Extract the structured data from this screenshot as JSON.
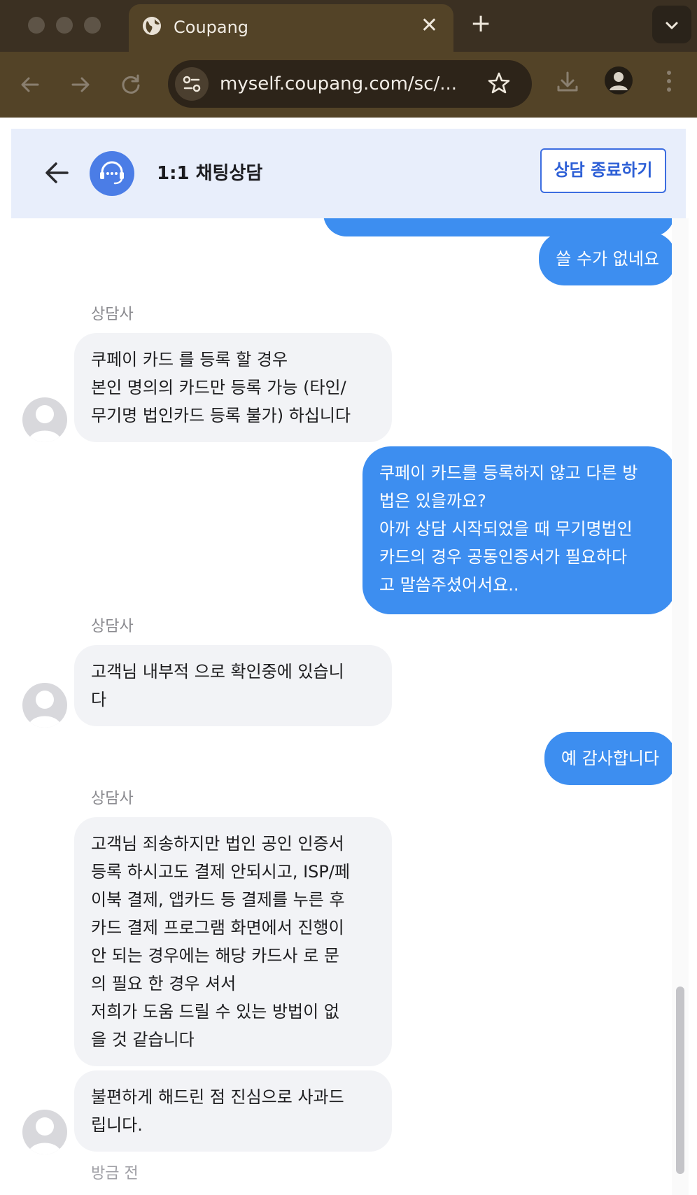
{
  "browser": {
    "tab_title": "Coupang",
    "url": "myself.coupang.com/sc/...",
    "new_tab_symbol": "+",
    "close_symbol": "✕"
  },
  "header": {
    "title": "1:1 채팅상담",
    "end_button": "상담 종료하기"
  },
  "messages": [
    {
      "from": "me",
      "text": "쓸 수가 없네요"
    },
    {
      "from": "agent",
      "sender": "상담사",
      "text": "쿠페이 카드 를 등록 할 경우\n본인 명의의 카드만 등록 가능 (타인/\n무기명 법인카드 등록 불가) 하십니다"
    },
    {
      "from": "me",
      "text": "쿠페이 카드를 등록하지 않고 다른 방\n법은 있을까요?\n아까 상담 시작되었을 때 무기명법인\n카드의 경우 공동인증서가 필요하다\n고 말씀주셨어서요.."
    },
    {
      "from": "agent",
      "sender": "상담사",
      "text": "고객님 내부적 으로 확인중에 있습니\n다"
    },
    {
      "from": "me",
      "text": "예 감사합니다"
    },
    {
      "from": "agent",
      "sender": "상담사",
      "text": "고객님 죄송하지만 법인 공인 인증서\n등록 하시고도 결제 안되시고, ISP/페\n이북 결제, 앱카드 등 결제를 누른 후\n카드 결제 프로그램 화면에서 진행이\n안 되는 경우에는 해당 카드사 로 문\n의 필요 한 경우 셔서\n저희가 도움 드릴 수 있는 방법이 없\n을 것 같습니다"
    },
    {
      "from": "agent",
      "text": "불편하게 해드린 점 진심으로 사과드\n립니다."
    }
  ],
  "timestamp": "방금 전",
  "colors": {
    "my_bubble": "#3d8ef0",
    "agent_bubble": "#f2f3f6",
    "header_bg": "#e8eefb",
    "accent": "#3c6de0"
  }
}
